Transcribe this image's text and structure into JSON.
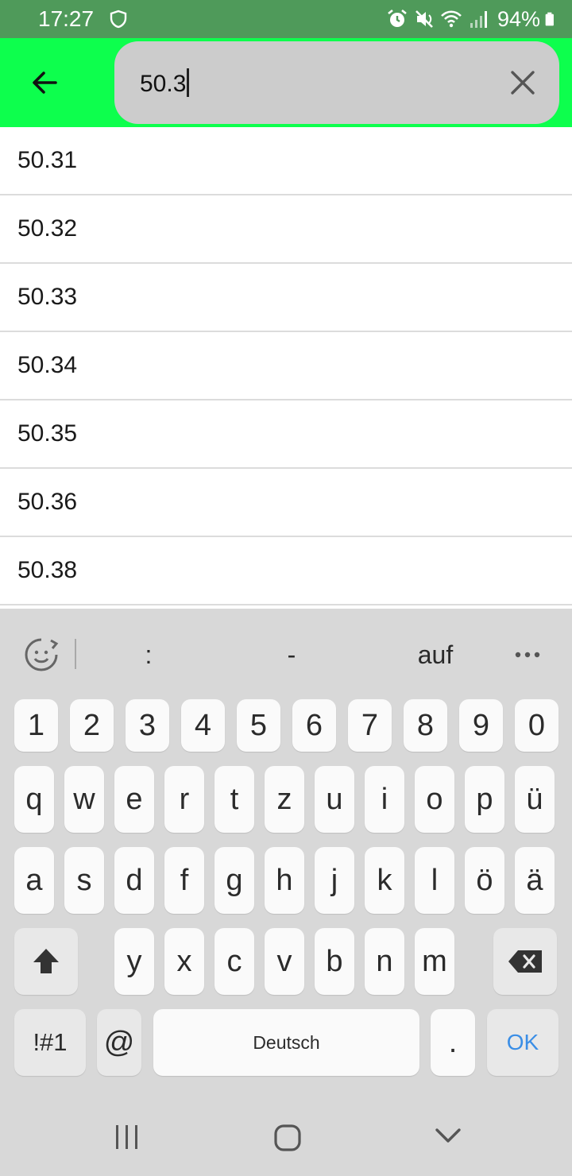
{
  "status_bar": {
    "time": "17:27",
    "battery": "94%"
  },
  "search": {
    "value": "50.3"
  },
  "results": [
    "50.31",
    "50.32",
    "50.33",
    "50.34",
    "50.35",
    "50.36",
    "50.38"
  ],
  "keyboard": {
    "suggestions": [
      ":",
      "-",
      "auf"
    ],
    "number_row": [
      "1",
      "2",
      "3",
      "4",
      "5",
      "6",
      "7",
      "8",
      "9",
      "0"
    ],
    "row1": [
      "q",
      "w",
      "e",
      "r",
      "t",
      "z",
      "u",
      "i",
      "o",
      "p",
      "ü"
    ],
    "row2": [
      "a",
      "s",
      "d",
      "f",
      "g",
      "h",
      "j",
      "k",
      "l",
      "ö",
      "ä"
    ],
    "row3": [
      "y",
      "x",
      "c",
      "v",
      "b",
      "n",
      "m"
    ],
    "symbols_label": "!#1",
    "at_label": "@",
    "space_label": "Deutsch",
    "period_label": ".",
    "ok_label": "OK",
    "ok_color": "#3a8ee6"
  },
  "colors": {
    "header": "#0dff4d",
    "status_bar": "#4f9a5a",
    "search_field": "#cccccc"
  }
}
